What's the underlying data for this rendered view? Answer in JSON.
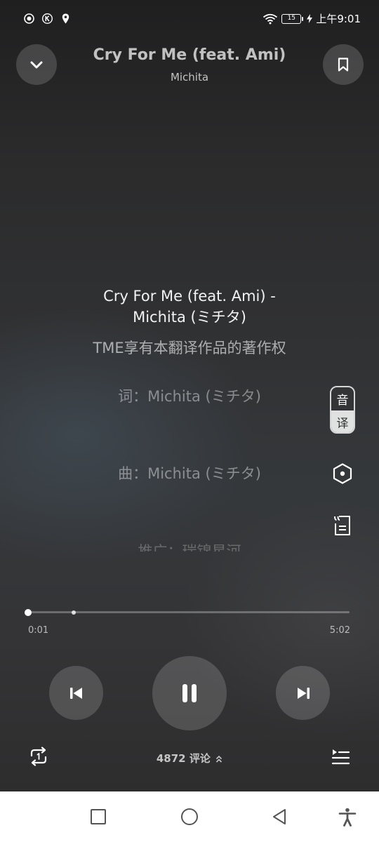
{
  "status_bar": {
    "time": "上午9:01",
    "battery": "15",
    "left_icons": [
      "record-icon",
      "k-badge-icon",
      "location-icon"
    ],
    "right_icons": [
      "wifi-icon",
      "battery-icon",
      "charging-icon"
    ]
  },
  "header": {
    "title": "Cry For Me (feat. Ami)",
    "artist": "Michita",
    "left_button_icon": "chevron-down-icon",
    "right_button_icon": "bookmark-icon"
  },
  "lyrics": {
    "current_line_1": "Cry For Me (feat. Ami) -",
    "current_line_2": "Michita (ミチタ)",
    "copyright": "TME享有本翻译作品的著作权",
    "lyricist": "词：Michita (ミチタ)",
    "composer": "曲：Michita (ミチタ)",
    "next_partial": "推广：瑞锦星河"
  },
  "side_tools": {
    "toggle_top": "音",
    "toggle_bottom": "译",
    "icons": [
      "hexagon-icon",
      "lyric-poster-icon"
    ]
  },
  "playback": {
    "elapsed": "0:01",
    "duration": "5:02",
    "progress": 0.003,
    "buffered": 0.14
  },
  "controls": {
    "prev_icon": "previous-icon",
    "play_pause_icon": "pause-icon",
    "next_icon": "next-icon"
  },
  "bottom": {
    "repeat_icon": "repeat-one-icon",
    "comments_count": "4872",
    "comments_label": "评论",
    "playlist_icon": "playlist-icon"
  },
  "nav_bar": {
    "icons": [
      "recent-apps-icon",
      "home-icon",
      "back-icon",
      "accessibility-icon"
    ]
  },
  "colors": {
    "background": "#2e2e2f",
    "nav_bar": "#ffffff",
    "text": "#ffffff"
  }
}
